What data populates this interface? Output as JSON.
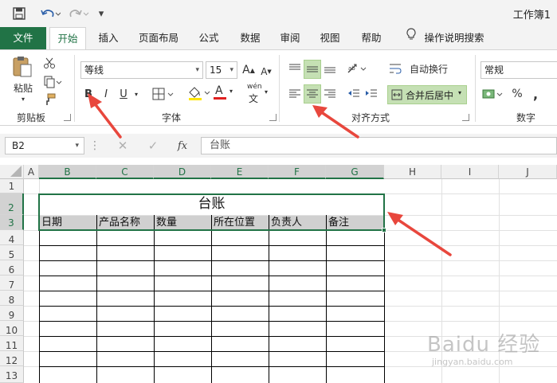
{
  "window": {
    "title": "工作簿1"
  },
  "quick_access": {
    "more": "▾"
  },
  "tabs": [
    "文件",
    "开始",
    "插入",
    "页面布局",
    "公式",
    "数据",
    "审阅",
    "视图",
    "帮助",
    "操作说明搜索"
  ],
  "active_tab": "开始",
  "ribbon": {
    "clipboard": {
      "paste": "粘贴",
      "label": "剪贴板"
    },
    "font": {
      "name": "等线",
      "size": "15",
      "bold": "B",
      "italic": "I",
      "underline": "U",
      "grow": "A",
      "shrink": "A",
      "font_color": "A",
      "phonetic": "wén",
      "label": "字体"
    },
    "alignment": {
      "wrap": "自动换行",
      "merge": "合并后居中",
      "label": "对齐方式"
    },
    "number": {
      "format": "常规",
      "percent": "%",
      "comma": ",",
      "label": "数字"
    }
  },
  "formula_bar": {
    "name_box": "B2",
    "fx": "fx",
    "content": "台账"
  },
  "sheet": {
    "columns": [
      "A",
      "B",
      "C",
      "D",
      "E",
      "F",
      "G",
      "H",
      "I",
      "J"
    ],
    "selected_columns": [
      "B",
      "C",
      "D",
      "E",
      "F",
      "G"
    ],
    "rows": [
      "1",
      "2",
      "3",
      "4",
      "5",
      "6",
      "7",
      "8",
      "9",
      "10",
      "11",
      "12",
      "13"
    ],
    "selected_rows": [
      "2",
      "3"
    ],
    "title": "台账",
    "headers": [
      "日期",
      "产品名称",
      "数量",
      "所在位置",
      "负责人",
      "备注"
    ]
  },
  "watermark": {
    "main": "Baidu 经验",
    "sub": "jingyan.baidu.com"
  },
  "colors": {
    "accent": "#217346",
    "arrow": "#e8473d",
    "highlight": "#c5e0b4"
  }
}
